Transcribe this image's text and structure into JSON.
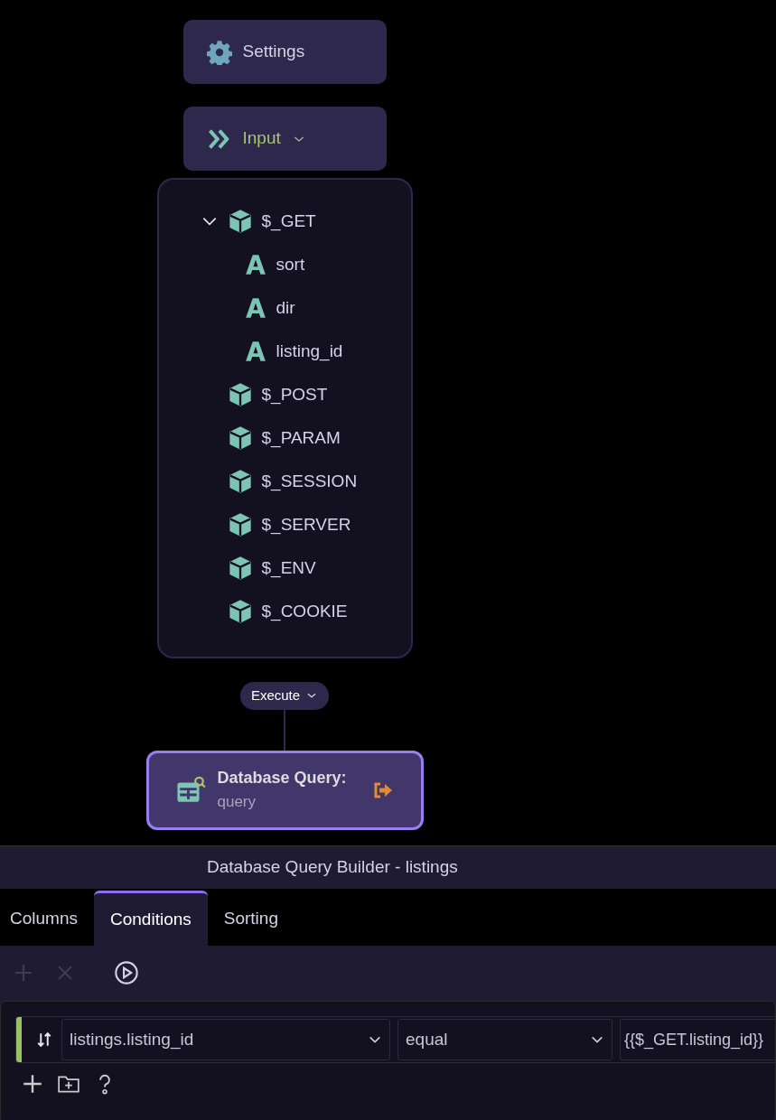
{
  "nodes": [
    {
      "kind": "settings",
      "label": "Settings"
    },
    {
      "kind": "input",
      "label": "Input",
      "expanded": true
    }
  ],
  "tree": [
    {
      "kind": "object",
      "label": "$_GET",
      "children": [
        {
          "kind": "string",
          "label": "sort"
        },
        {
          "kind": "string",
          "label": "dir"
        },
        {
          "kind": "string",
          "label": "listing_id"
        }
      ]
    },
    {
      "kind": "object",
      "label": "$_POST"
    },
    {
      "kind": "object",
      "label": "$_PARAM"
    },
    {
      "kind": "object",
      "label": "$_SESSION"
    },
    {
      "kind": "object",
      "label": "$_SERVER"
    },
    {
      "kind": "object",
      "label": "$_ENV"
    },
    {
      "kind": "object",
      "label": "$_COOKIE"
    }
  ],
  "execute": {
    "label": "Execute"
  },
  "query_node": {
    "title": "Database Query:",
    "subtitle": "query",
    "selected": true
  },
  "panel": {
    "title": "Database Query Builder - listings",
    "tabs": [
      {
        "label": "Columns",
        "selected": false
      },
      {
        "label": "Conditions",
        "selected": true
      },
      {
        "label": "Sorting",
        "selected": false
      }
    ],
    "toolbar": [
      {
        "kind": "add",
        "disabled": true
      },
      {
        "kind": "remove",
        "disabled": true
      },
      {
        "kind": "run",
        "disabled": false
      }
    ],
    "conditions": [
      {
        "color": "#9bbf62",
        "field": "listings.listing_id",
        "operator": "equal",
        "value": "{{$_GET.listing_id}}"
      }
    ],
    "footer_actions": [
      {
        "kind": "add"
      },
      {
        "kind": "group"
      },
      {
        "kind": "help"
      }
    ]
  }
}
